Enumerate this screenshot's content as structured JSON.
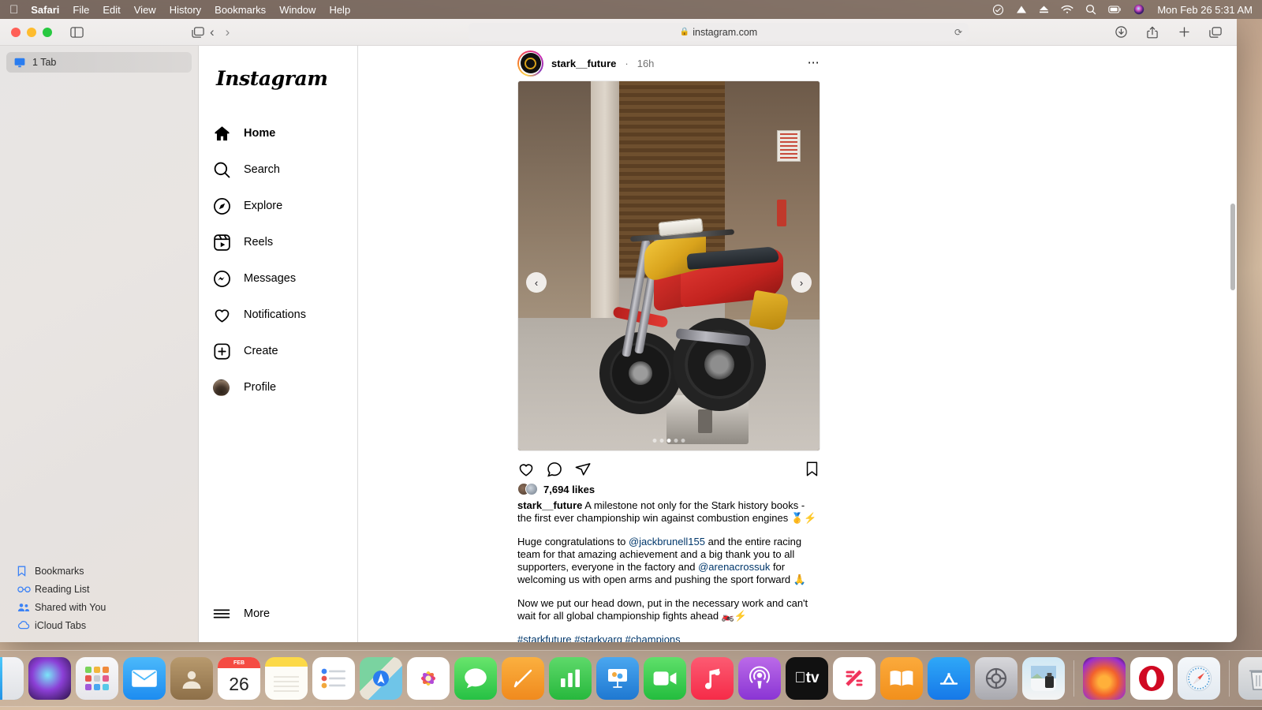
{
  "menubar": {
    "apple_icon": "apple-icon",
    "items": [
      "Safari",
      "File",
      "Edit",
      "View",
      "History",
      "Bookmarks",
      "Window",
      "Help"
    ],
    "status_icons": [
      "control-center-icon",
      "triangle-icon",
      "eject-icon",
      "wifi-icon",
      "search-icon",
      "battery-icon",
      "siri-icon"
    ],
    "clock": "Mon Feb 26  5:31 AM"
  },
  "browser": {
    "toolbar": {
      "sidebar_toggle_icon": "sidebar-toggle-icon",
      "tab_overview_icon": "tab-overview-icon",
      "back_icon": "chevron-left-icon",
      "forward_icon": "chevron-right-icon",
      "url": "instagram.com",
      "lock_icon": "lock-icon",
      "reload_icon": "reload-icon",
      "download_icon": "download-icon",
      "share_icon": "share-icon",
      "new_tab_icon": "plus-icon",
      "tabs_icon": "copy-tabs-icon"
    },
    "sidebar": {
      "tab_group_label": "1 Tab",
      "tab_group_icon": "display-icon",
      "items": [
        {
          "label": "Bookmarks",
          "icon": "bookmark-icon"
        },
        {
          "label": "Reading List",
          "icon": "glasses-icon"
        },
        {
          "label": "Shared with You",
          "icon": "shared-people-icon"
        },
        {
          "label": "iCloud Tabs",
          "icon": "cloud-icon"
        }
      ]
    }
  },
  "instagram": {
    "logo": "Instagram",
    "nav": [
      {
        "label": "Home",
        "icon": "home-icon",
        "active": true
      },
      {
        "label": "Search",
        "icon": "search-icon",
        "active": false
      },
      {
        "label": "Explore",
        "icon": "compass-icon",
        "active": false
      },
      {
        "label": "Reels",
        "icon": "reels-icon",
        "active": false
      },
      {
        "label": "Messages",
        "icon": "messenger-icon",
        "active": false
      },
      {
        "label": "Notifications",
        "icon": "heart-icon",
        "active": false
      },
      {
        "label": "Create",
        "icon": "plus-square-icon",
        "active": false
      },
      {
        "label": "Profile",
        "icon": "avatar-icon",
        "active": false
      }
    ],
    "more": {
      "label": "More",
      "icon": "hamburger-icon"
    },
    "post": {
      "username": "stark__future",
      "separator": "·",
      "timestamp": "16h",
      "more_icon": "ellipsis-icon",
      "avatar_icon": "story-ring-avatar",
      "media_alt": "electric dirt bike parked in a garage",
      "prev_icon": "chevron-left-icon",
      "next_icon": "chevron-right-icon",
      "carousel_total": 5,
      "carousel_active": 3,
      "actions": {
        "like_icon": "heart-icon",
        "comment_icon": "comment-icon",
        "share_icon": "share-paperplane-icon",
        "save_icon": "bookmark-icon"
      },
      "likes": "7,694 likes",
      "caption_para1_prefix": "stark__future",
      "caption_para1": " A milestone not only for the Stark history books - the first ever championship win against combustion engines 🥇⚡",
      "caption_para2_a": "Huge congratulations to ",
      "caption_para2_m1": "@jackbrunell155",
      "caption_para2_b": " and the entire racing team for that amazing achievement and a big thank you to all supporters, everyone in the factory and ",
      "caption_para2_m2": "@arenacrossuk",
      "caption_para2_c": " for welcoming us with open arms and pushing the sport forward 🙏",
      "caption_para3": "Now we put our head down, put in the necessary work and can't wait for all global championship fights ahead 🏍️⚡",
      "hashtags": "#starkfuture #starkvarg #champions"
    }
  },
  "dock": {
    "apps": [
      {
        "name": "finder",
        "label": "Finder"
      },
      {
        "name": "siri",
        "label": "Siri"
      },
      {
        "name": "launchpad",
        "label": "Launchpad"
      },
      {
        "name": "mail",
        "label": "Mail"
      },
      {
        "name": "contacts",
        "label": "Contacts"
      },
      {
        "name": "calendar",
        "label": "Calendar",
        "month": "FEB",
        "day": "26"
      },
      {
        "name": "notes",
        "label": "Notes"
      },
      {
        "name": "reminders",
        "label": "Reminders"
      },
      {
        "name": "maps",
        "label": "Maps"
      },
      {
        "name": "photos",
        "label": "Photos"
      },
      {
        "name": "messages",
        "label": "Messages"
      },
      {
        "name": "pages",
        "label": "Pages"
      },
      {
        "name": "numbers",
        "label": "Numbers"
      },
      {
        "name": "keynote",
        "label": "Keynote"
      },
      {
        "name": "facetime",
        "label": "FaceTime"
      },
      {
        "name": "music",
        "label": "Music"
      },
      {
        "name": "podcasts",
        "label": "Podcasts"
      },
      {
        "name": "appletv",
        "label": "Apple TV"
      },
      {
        "name": "news",
        "label": "News"
      },
      {
        "name": "books",
        "label": "Books"
      },
      {
        "name": "appstore",
        "label": "App Store"
      },
      {
        "name": "settings",
        "label": "System Settings"
      },
      {
        "name": "preview",
        "label": "Preview"
      },
      {
        "name": "firefox",
        "label": "Firefox"
      },
      {
        "name": "opera",
        "label": "Opera"
      },
      {
        "name": "safari",
        "label": "Safari"
      },
      {
        "name": "trash",
        "label": "Trash"
      }
    ]
  },
  "colors": {
    "ig_link": "#00376b",
    "accent_blue": "#3b82f6",
    "border": "#dbdbdb"
  }
}
